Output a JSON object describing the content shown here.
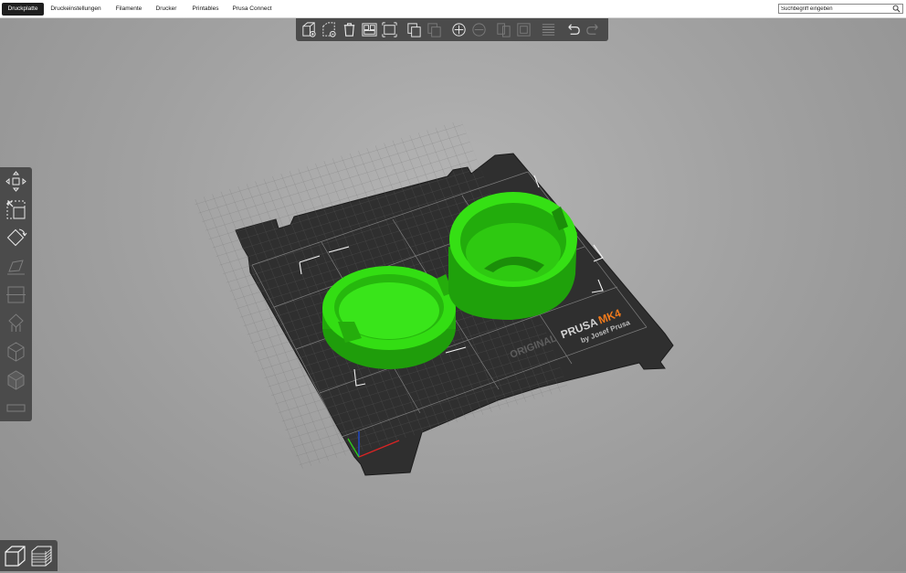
{
  "tabs": [
    {
      "label": "Druckplatte",
      "active": true
    },
    {
      "label": "Druckeinstellungen",
      "active": false
    },
    {
      "label": "Filamente",
      "active": false
    },
    {
      "label": "Drucker",
      "active": false
    },
    {
      "label": "Printables",
      "active": false
    },
    {
      "label": "Prusa Connect",
      "active": false
    }
  ],
  "search": {
    "placeholder": "Suchbegriff eingeben",
    "value": "Suchbegriff eingeben"
  },
  "toolbar_icons": [
    "add-object-icon",
    "delete-icon",
    "delete-all-icon",
    "arrange-icon",
    "arrange-selection-icon",
    "copy-icon",
    "paste-icon",
    "add-instance-icon",
    "remove-instance-icon",
    "split-to-objects-icon",
    "split-to-parts-icon",
    "layers-editing-icon",
    "undo-icon",
    "redo-icon"
  ],
  "left_tools": [
    "move-icon",
    "scale-icon",
    "rotate-icon",
    "place-on-face-icon",
    "cut-icon",
    "supports-icon",
    "seam-icon",
    "mmu-paint-icon",
    "measure-icon"
  ],
  "bed": {
    "brand_line1": "ORIGINAL",
    "brand_line2": "PRUSA",
    "brand_model": "MK4",
    "brand_sub": "by Josef Prusa"
  },
  "colors": {
    "model": "#2bd40f",
    "model_dark": "#1e9b0a",
    "bed": "#2e2e2e",
    "accent": "#f07a1c",
    "toolbar": "#4b4b4b"
  },
  "view_switch": [
    "3d-view-icon",
    "preview-icon"
  ]
}
